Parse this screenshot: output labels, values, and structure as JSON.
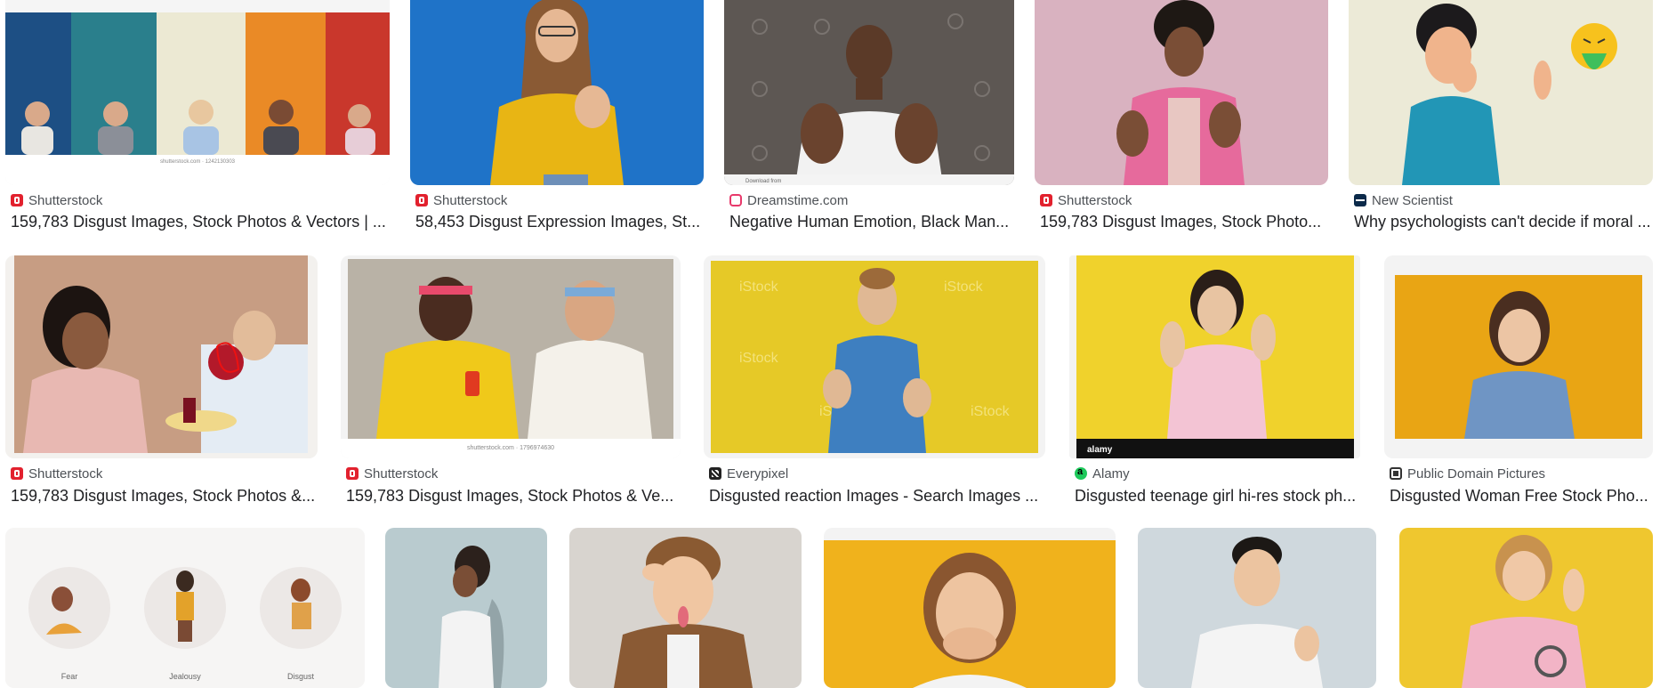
{
  "results_row1": [
    {
      "source": "Shutterstock",
      "favicon": "shutterstock-icon",
      "title": "159,783 Disgust Images, Stock Photos & Vectors | ..."
    },
    {
      "source": "Shutterstock",
      "favicon": "shutterstock-icon",
      "title": "58,453 Disgust Expression Images, St..."
    },
    {
      "source": "Dreamstime.com",
      "favicon": "dreamstime-icon",
      "title": "Negative Human Emotion, Black Man..."
    },
    {
      "source": "Shutterstock",
      "favicon": "shutterstock-icon",
      "title": "159,783 Disgust Images, Stock Photo..."
    },
    {
      "source": "New Scientist",
      "favicon": "new-scientist-icon",
      "title": "Why psychologists can't decide if moral ..."
    }
  ],
  "results_row2": [
    {
      "source": "Shutterstock",
      "favicon": "shutterstock-icon",
      "title": "159,783 Disgust Images, Stock Photos &..."
    },
    {
      "source": "Shutterstock",
      "favicon": "shutterstock-icon",
      "title": "159,783 Disgust Images, Stock Photos & Ve..."
    },
    {
      "source": "Everypixel",
      "favicon": "everypixel-icon",
      "title": "Disgusted reaction Images - Search Images ..."
    },
    {
      "source": "Alamy",
      "favicon": "alamy-icon",
      "title": "Disgusted teenage girl hi-res stock ph..."
    },
    {
      "source": "Public Domain Pictures",
      "favicon": "public-domain-pictures-icon",
      "title": "Disgusted Woman Free Stock Pho..."
    }
  ],
  "image_text": {
    "shutterstock_id_1": "shutterstock.com · 1242130303",
    "shutterstock_id_2": "shutterstock.com · 1796974630",
    "download_from": "Download from",
    "istock": "iStock",
    "alamy": "alamy",
    "emotion_labels": [
      "Fear",
      "Jealousy",
      "Disgust"
    ]
  },
  "colors": {
    "background": "#ffffff",
    "source_text": "#4d5156",
    "title_text": "#202124",
    "shutterstock_red": "#e2212e",
    "alamy_green": "#1ec95b"
  }
}
